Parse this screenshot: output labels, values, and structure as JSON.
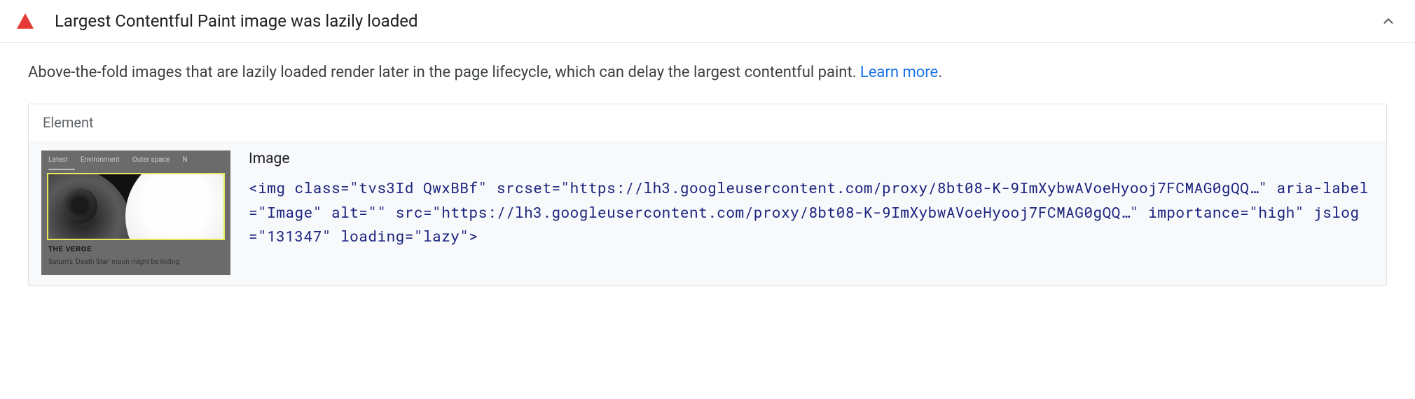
{
  "audit": {
    "title": "Largest Contentful Paint image was lazily loaded",
    "description_pre": "Above-the-fold images that are lazily loaded render later in the page lifecycle, which can delay the largest contentful paint. ",
    "learn_more_label": "Learn more",
    "description_post": "."
  },
  "table": {
    "header": "Element"
  },
  "element": {
    "name": "Image",
    "thumb": {
      "tab1": "Latest",
      "tab2": "Environment",
      "tab3": "Outer space",
      "tab4": "N",
      "brand": "THE VERGE",
      "caption": "Saturn's 'Death Star' moon might be hiding"
    },
    "snippet": {
      "open": "<",
      "tag": "img",
      "sp": " ",
      "attrs": [
        {
          "name": "class",
          "eq": "=",
          "q": "\"",
          "value": "tvs3Id QwxBBf",
          "cq": "\""
        },
        {
          "name": "srcset",
          "eq": "=",
          "q": "\"",
          "value": "https://lh3.googleusercontent.com/proxy/8bt08-K-9ImXybwAVoeHyooj7FCMAG0gQQ…",
          "cq": "\""
        },
        {
          "name": "aria-label",
          "eq": "=",
          "q": "\"",
          "value": "Image",
          "cq": "\""
        },
        {
          "name": "alt",
          "eq": "=",
          "q": "\"",
          "value": "",
          "cq": "\""
        },
        {
          "name": "src",
          "eq": "=",
          "q": "\"",
          "value": "https://lh3.googleusercontent.com/proxy/8bt08-K-9ImXybwAVoeHyooj7FCMAG0gQQ…",
          "cq": "\""
        },
        {
          "name": "importance",
          "eq": "=",
          "q": "\"",
          "value": "high",
          "cq": "\""
        },
        {
          "name": "jslog",
          "eq": "=",
          "q": "\"",
          "value": "131347",
          "cq": "\""
        },
        {
          "name": "loading",
          "eq": "=",
          "q": "\"",
          "value": "lazy",
          "cq": "\""
        }
      ],
      "close": ">"
    }
  }
}
